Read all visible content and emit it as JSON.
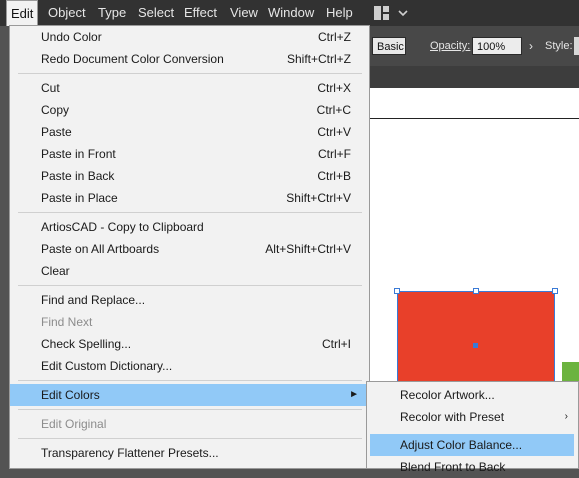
{
  "menubar": {
    "items": [
      "Edit",
      "Object",
      "Type",
      "Select",
      "Effect",
      "View",
      "Window",
      "Help"
    ],
    "active": "Edit"
  },
  "controlbar": {
    "style_preset": "Basic",
    "opacity_label": "Opacity:",
    "opacity_value": "100%",
    "style_label": "Style:"
  },
  "edit_menu": {
    "items": [
      {
        "label": "Undo Color",
        "shortcut": "Ctrl+Z",
        "enabled": true
      },
      {
        "label": "Redo Document Color Conversion",
        "shortcut": "Shift+Ctrl+Z",
        "enabled": true
      },
      {
        "label": "Cut",
        "shortcut": "Ctrl+X",
        "enabled": true
      },
      {
        "label": "Copy",
        "shortcut": "Ctrl+C",
        "enabled": true
      },
      {
        "label": "Paste",
        "shortcut": "Ctrl+V",
        "enabled": true
      },
      {
        "label": "Paste in Front",
        "shortcut": "Ctrl+F",
        "enabled": true
      },
      {
        "label": "Paste in Back",
        "shortcut": "Ctrl+B",
        "enabled": true
      },
      {
        "label": "Paste in Place",
        "shortcut": "Shift+Ctrl+V",
        "enabled": true
      },
      {
        "label": "ArtiosCAD - Copy to Clipboard",
        "shortcut": "",
        "enabled": true
      },
      {
        "label": "Paste on All Artboards",
        "shortcut": "Alt+Shift+Ctrl+V",
        "enabled": true
      },
      {
        "label": "Clear",
        "shortcut": "",
        "enabled": true
      },
      {
        "label": "Find and Replace...",
        "shortcut": "",
        "enabled": true
      },
      {
        "label": "Find Next",
        "shortcut": "",
        "enabled": false
      },
      {
        "label": "Check Spelling...",
        "shortcut": "Ctrl+I",
        "enabled": true
      },
      {
        "label": "Edit Custom Dictionary...",
        "shortcut": "",
        "enabled": true
      },
      {
        "label": "Edit Colors",
        "shortcut": "",
        "enabled": true,
        "submenu": true,
        "highlighted": true
      },
      {
        "label": "Edit Original",
        "shortcut": "",
        "enabled": false
      },
      {
        "label": "Transparency Flattener Presets...",
        "shortcut": "",
        "enabled": true
      }
    ]
  },
  "edit_colors_submenu": {
    "items": [
      {
        "label": "Recolor Artwork...",
        "submenu": false
      },
      {
        "label": "Recolor with Preset",
        "submenu": true
      },
      {
        "label": "Adjust Color Balance...",
        "submenu": false,
        "highlighted": true
      },
      {
        "label": "Blend Front to Back",
        "submenu": false
      }
    ]
  },
  "colors": {
    "menubar_bg": "#323232",
    "menu_bg": "#f2f2f2",
    "highlight": "#91c9f7",
    "red_object": "#e8402a",
    "green_object": "#6cb33f",
    "selection": "#3a7ad6"
  }
}
